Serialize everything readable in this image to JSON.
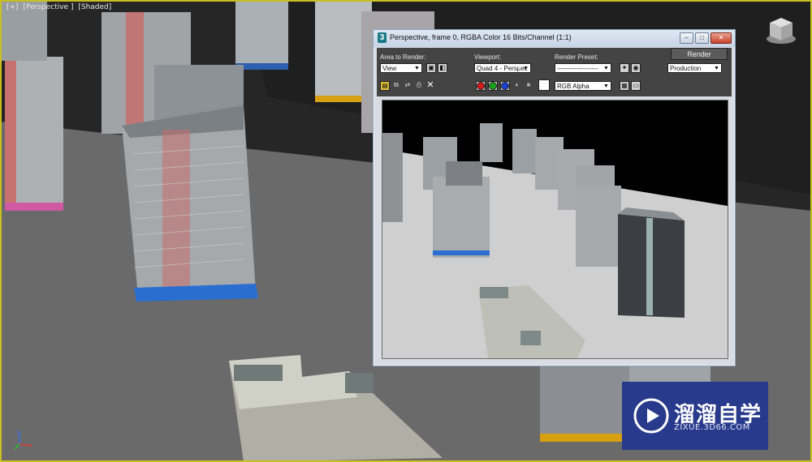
{
  "viewport": {
    "label_parts": [
      "[+]",
      "[Perspective ]",
      "[Shaded]"
    ]
  },
  "render_window": {
    "title": "Perspective, frame 0, RGBA Color 16 Bits/Channel (1:1)",
    "controls": {
      "minimize": "–",
      "maximize": "□",
      "close": "✕"
    },
    "area_to_render": {
      "label": "Area to Render:",
      "value": "View"
    },
    "viewport_select": {
      "label": "Viewport:",
      "value": "Quad 4 - Perspec"
    },
    "render_preset": {
      "label": "Render Preset:",
      "value": "-------------------"
    },
    "render_button": "Render",
    "production_select": "Production",
    "channel_select": "RGB Alpha",
    "colors": {
      "accent_border": "#c8c020",
      "red_channel": "#d11a1a",
      "green_channel": "#1aa31a",
      "blue_channel": "#1a3fd1"
    }
  },
  "watermark": {
    "brand_text": "溜溜自学",
    "url": "ZIXUE.3D66.COM",
    "color": "#283a8c"
  },
  "icons": [
    "viewcube-icon",
    "axis-gizmo-icon",
    "app-icon",
    "save-image-icon",
    "copy-image-icon",
    "clone-window-icon",
    "print-icon",
    "clear-icon",
    "lock-icon",
    "environment-icon",
    "render-setup-icon",
    "monochrome-icon",
    "display-alpha-icon"
  ]
}
